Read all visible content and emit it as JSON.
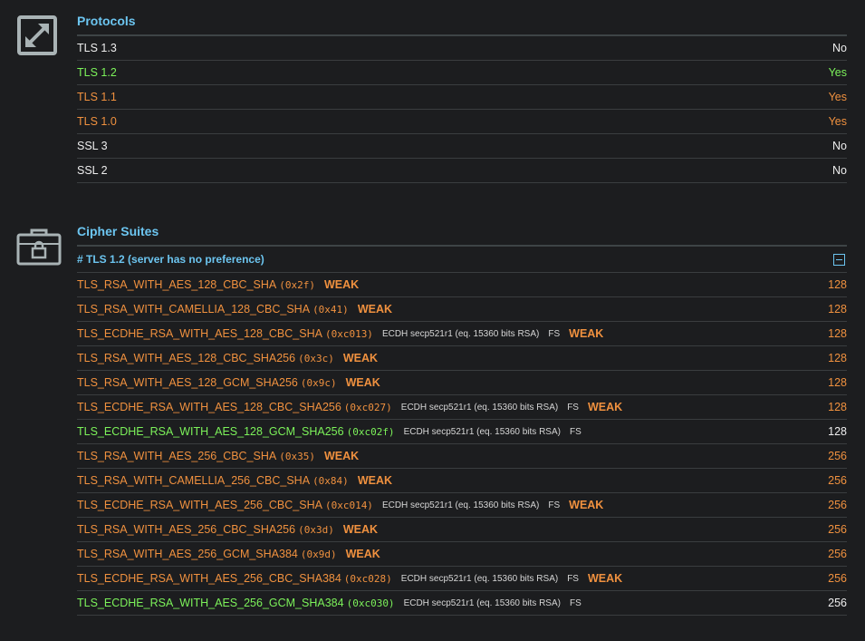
{
  "protocols": {
    "title": "Protocols",
    "icon": "expand-arrows-icon",
    "rows": [
      {
        "name": "TLS 1.3",
        "value": "No",
        "status": "white"
      },
      {
        "name": "TLS 1.2",
        "value": "Yes",
        "status": "green"
      },
      {
        "name": "TLS 1.1",
        "value": "Yes",
        "status": "orange"
      },
      {
        "name": "TLS 1.0",
        "value": "Yes",
        "status": "orange"
      },
      {
        "name": "SSL 3",
        "value": "No",
        "status": "white"
      },
      {
        "name": "SSL 2",
        "value": "No",
        "status": "white"
      }
    ]
  },
  "cipher_suites": {
    "title": "Cipher Suites",
    "icon": "lock-briefcase-icon",
    "group_label": "# TLS 1.2 (server has no preference)",
    "rows": [
      {
        "name": "TLS_RSA_WITH_AES_128_CBC_SHA",
        "hex": "(0x2f)",
        "kx": "",
        "fs": "",
        "weak": "WEAK",
        "bits": "128",
        "status": "orange"
      },
      {
        "name": "TLS_RSA_WITH_CAMELLIA_128_CBC_SHA",
        "hex": "(0x41)",
        "kx": "",
        "fs": "",
        "weak": "WEAK",
        "bits": "128",
        "status": "orange"
      },
      {
        "name": "TLS_ECDHE_RSA_WITH_AES_128_CBC_SHA",
        "hex": "(0xc013)",
        "kx": "ECDH secp521r1 (eq. 15360 bits RSA)",
        "fs": "FS",
        "weak": "WEAK",
        "bits": "128",
        "status": "orange"
      },
      {
        "name": "TLS_RSA_WITH_AES_128_CBC_SHA256",
        "hex": "(0x3c)",
        "kx": "",
        "fs": "",
        "weak": "WEAK",
        "bits": "128",
        "status": "orange"
      },
      {
        "name": "TLS_RSA_WITH_AES_128_GCM_SHA256",
        "hex": "(0x9c)",
        "kx": "",
        "fs": "",
        "weak": "WEAK",
        "bits": "128",
        "status": "orange"
      },
      {
        "name": "TLS_ECDHE_RSA_WITH_AES_128_CBC_SHA256",
        "hex": "(0xc027)",
        "kx": "ECDH secp521r1 (eq. 15360 bits RSA)",
        "fs": "FS",
        "weak": "WEAK",
        "bits": "128",
        "status": "orange"
      },
      {
        "name": "TLS_ECDHE_RSA_WITH_AES_128_GCM_SHA256",
        "hex": "(0xc02f)",
        "kx": "ECDH secp521r1 (eq. 15360 bits RSA)",
        "fs": "FS",
        "weak": "",
        "bits": "128",
        "status": "green"
      },
      {
        "name": "TLS_RSA_WITH_AES_256_CBC_SHA",
        "hex": "(0x35)",
        "kx": "",
        "fs": "",
        "weak": "WEAK",
        "bits": "256",
        "status": "orange"
      },
      {
        "name": "TLS_RSA_WITH_CAMELLIA_256_CBC_SHA",
        "hex": "(0x84)",
        "kx": "",
        "fs": "",
        "weak": "WEAK",
        "bits": "256",
        "status": "orange"
      },
      {
        "name": "TLS_ECDHE_RSA_WITH_AES_256_CBC_SHA",
        "hex": "(0xc014)",
        "kx": "ECDH secp521r1 (eq. 15360 bits RSA)",
        "fs": "FS",
        "weak": "WEAK",
        "bits": "256",
        "status": "orange"
      },
      {
        "name": "TLS_RSA_WITH_AES_256_CBC_SHA256",
        "hex": "(0x3d)",
        "kx": "",
        "fs": "",
        "weak": "WEAK",
        "bits": "256",
        "status": "orange"
      },
      {
        "name": "TLS_RSA_WITH_AES_256_GCM_SHA384",
        "hex": "(0x9d)",
        "kx": "",
        "fs": "",
        "weak": "WEAK",
        "bits": "256",
        "status": "orange"
      },
      {
        "name": "TLS_ECDHE_RSA_WITH_AES_256_CBC_SHA384",
        "hex": "(0xc028)",
        "kx": "ECDH secp521r1 (eq. 15360 bits RSA)",
        "fs": "FS",
        "weak": "WEAK",
        "bits": "256",
        "status": "orange"
      },
      {
        "name": "TLS_ECDHE_RSA_WITH_AES_256_GCM_SHA384",
        "hex": "(0xc030)",
        "kx": "ECDH secp521r1 (eq. 15360 bits RSA)",
        "fs": "FS",
        "weak": "",
        "bits": "256",
        "status": "green"
      }
    ]
  },
  "colors": {
    "background": "#1c1d1f",
    "accent": "#6cc5f0",
    "ok": "#7cf25a",
    "warn": "#f0913f",
    "text": "#eeeeee"
  }
}
